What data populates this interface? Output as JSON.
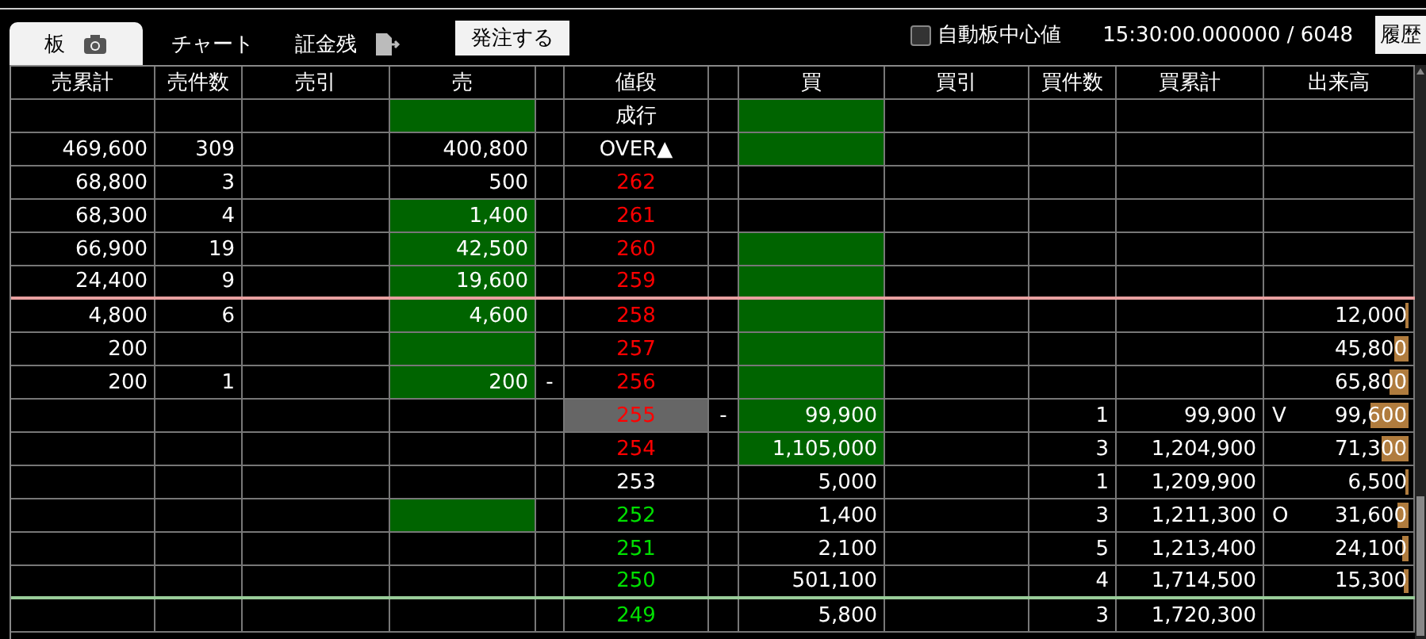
{
  "tabs": [
    {
      "label": "板",
      "kind": "photo",
      "selected": true
    },
    {
      "label": "チャート",
      "kind": "plain",
      "selected": false
    },
    {
      "label": "証金残",
      "kind": "transfer",
      "selected": false
    }
  ],
  "order_button": "発注する",
  "auto_center": {
    "label": "自動板中心値",
    "checked": false
  },
  "timestamp": "15:30:00.000000 / 6048",
  "history_button": "履歴",
  "columns": [
    "売累計",
    "売件数",
    "売引",
    "売",
    "",
    "値段",
    "",
    "買",
    "買引",
    "買件数",
    "買累計",
    "出来高"
  ],
  "rows": [
    {
      "price": "成行",
      "color": "#ffffff",
      "sell_hl": true,
      "buy_hl": true,
      "current": false
    },
    {
      "sell_cum": "469,600",
      "sell_count": "309",
      "sell_qty": "400,800",
      "price": "OVER▲",
      "color": "#ffffff",
      "sell_hl": false,
      "buy_hl": true,
      "current": false
    },
    {
      "sell_cum": "68,800",
      "sell_count": "3",
      "sell_qty": "500",
      "price": "262",
      "color": "#ff0000",
      "sell_hl": false,
      "buy_hl": false,
      "current": false
    },
    {
      "sell_cum": "68,300",
      "sell_count": "4",
      "sell_qty": "1,400",
      "price": "261",
      "color": "#ff0000",
      "sell_hl": true,
      "buy_hl": false,
      "current": false
    },
    {
      "sell_cum": "66,900",
      "sell_count": "19",
      "sell_qty": "42,500",
      "price": "260",
      "color": "#ff0000",
      "sell_hl": true,
      "buy_hl": true,
      "current": false
    },
    {
      "sell_cum": "24,400",
      "sell_count": "9",
      "sell_qty": "19,600",
      "price": "259",
      "color": "#ff0000",
      "sell_hl": true,
      "buy_hl": true,
      "current": false,
      "kind": "best_ask"
    },
    {
      "sell_cum": "4,800",
      "sell_count": "6",
      "sell_qty": "4,600",
      "price": "258",
      "color": "#ff0000",
      "sell_hl": true,
      "buy_hl": true,
      "current": false,
      "volume": "12,000",
      "level": 0.02
    },
    {
      "sell_cum": "200",
      "price": "257",
      "color": "#ff0000",
      "sell_hl": true,
      "buy_hl": true,
      "current": false,
      "volume": "45,800",
      "level": 0.1
    },
    {
      "sell_cum": "200",
      "sell_count": "1",
      "sell_qty": "200",
      "sell_mark": "-",
      "price": "256",
      "color": "#ff0000",
      "sell_hl": true,
      "buy_hl": true,
      "current": false,
      "volume": "65,800",
      "level": 0.13
    },
    {
      "price": "255",
      "color": "#ff0000",
      "sell_hl": false,
      "buy_hl": true,
      "current": true,
      "buy_mark": "-",
      "buy_qty": "99,900",
      "buy_count": "1",
      "buy_cum": "99,900",
      "flag": "V",
      "volume": "99,600",
      "level": 0.27
    },
    {
      "price": "254",
      "color": "#ff0000",
      "sell_hl": false,
      "buy_hl": true,
      "current": false,
      "buy_qty": "1,105,000",
      "buy_count": "3",
      "buy_cum": "1,204,900",
      "volume": "71,300",
      "level": 0.19
    },
    {
      "price": "253",
      "color": "#ffffff",
      "sell_hl": false,
      "buy_hl": false,
      "current": false,
      "buy_qty": "5,000",
      "buy_count": "1",
      "buy_cum": "1,209,900",
      "volume": "6,500",
      "level": 0.02
    },
    {
      "price": "252",
      "color": "#00e000",
      "sell_hl": true,
      "buy_hl": false,
      "current": false,
      "buy_qty": "1,400",
      "buy_count": "3",
      "buy_cum": "1,211,300",
      "flag": "O",
      "volume": "31,600",
      "level": 0.08
    },
    {
      "price": "251",
      "color": "#00e000",
      "sell_hl": false,
      "buy_hl": false,
      "current": false,
      "buy_qty": "2,100",
      "buy_count": "5",
      "buy_cum": "1,213,400",
      "volume": "24,100",
      "level": 0.05
    },
    {
      "price": "250",
      "color": "#00e000",
      "sell_hl": false,
      "buy_hl": false,
      "current": false,
      "buy_qty": "501,100",
      "buy_count": "4",
      "buy_cum": "1,714,500",
      "volume": "15,300",
      "level": 0.03,
      "kind": "best_bid"
    },
    {
      "price": "249",
      "color": "#00e000",
      "sell_hl": false,
      "buy_hl": false,
      "current": false,
      "buy_qty": "5,800",
      "buy_count": "3",
      "buy_cum": "1,720,300"
    }
  ]
}
